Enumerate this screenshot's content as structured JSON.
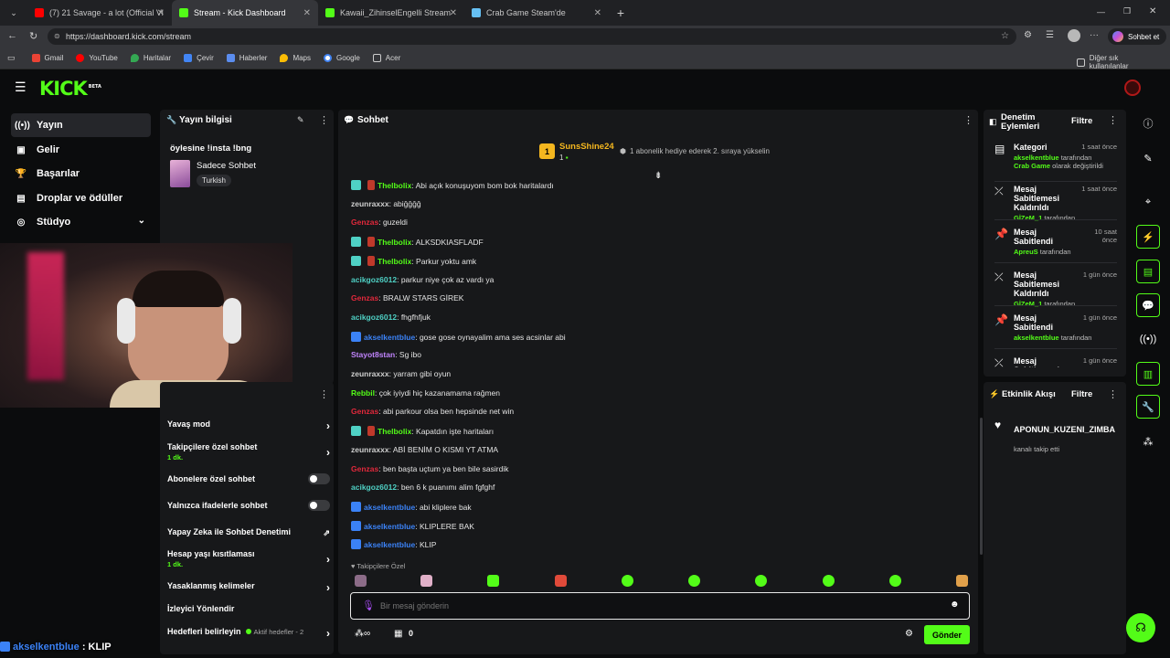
{
  "browser": {
    "tabs": [
      {
        "title": "(7) 21 Savage - a lot (Official Vide",
        "color": "#ff0000"
      },
      {
        "title": "Stream - Kick Dashboard",
        "color": "#53fc18"
      },
      {
        "title": "Kawaii_ZihinselEngelli Stream - W",
        "color": "#53fc18"
      },
      {
        "title": "Crab Game Steam'de",
        "color": "#66c0f4"
      }
    ],
    "url": "https://dashboard.kick.com/stream",
    "profile_button": "Sohbet et",
    "bookmarks": [
      "Gmail",
      "YouTube",
      "Haritalar",
      "Çevir",
      "Haberler",
      "Maps",
      "Google",
      "Acer"
    ],
    "other_bookmarks": "Diğer sık kullanılanlar"
  },
  "app": {
    "logo": "KICK",
    "logo_badge": "BETA",
    "nav": [
      {
        "label": "Yayın",
        "icon": "broadcast-icon"
      },
      {
        "label": "Gelir",
        "icon": "revenue-icon"
      },
      {
        "label": "Başarılar",
        "icon": "trophy-icon"
      },
      {
        "label": "Droplar ve ödüller",
        "icon": "gift-icon"
      },
      {
        "label": "Stüdyo",
        "icon": "studio-icon"
      }
    ],
    "stream_info": {
      "header": "Yayın bilgisi",
      "title": "öylesine !insta !bng",
      "category": "Sadece Sohbet",
      "tag": "Turkish"
    },
    "chat_settings": [
      {
        "label": "Yavaş mod",
        "sub": "",
        "control": "chevron"
      },
      {
        "label": "Takipçilere özel sohbet",
        "sub": "1 dk.",
        "control": "chevron"
      },
      {
        "label": "Abonelere özel sohbet",
        "sub": "",
        "control": "toggle"
      },
      {
        "label": "Yalnızca ifadelerle sohbet",
        "sub": "",
        "control": "toggle"
      },
      {
        "label": "Yapay Zeka ile Sohbet Denetimi",
        "sub": "",
        "control": "chart"
      },
      {
        "label": "Hesap yaşı kısıtlaması",
        "sub": "1 dk.",
        "control": "chevron"
      },
      {
        "label": "Yasaklanmış kelimeler",
        "sub": "",
        "control": "chevron"
      },
      {
        "label": "İzleyici Yönlendir",
        "sub": "",
        "control": "none"
      },
      {
        "label": "Hedefleri belirleyin",
        "sub": "",
        "control": "chevron",
        "extra": "Aktif hedefler - 2"
      }
    ],
    "overlay_caption": {
      "user": "akselkentblue",
      "text": " : KLIP"
    },
    "chat": {
      "header": "Sohbet",
      "gifter": {
        "name": "SunsShine24",
        "count": "1",
        "rank": "1",
        "message": "1 abonelik hediye ederek 2. sıraya yükselin"
      },
      "messages": [
        {
          "user": "Thelbolix",
          "color": "#53fc18",
          "badges": true,
          "text": ": Abi açık konuşuyom bom bok haritalardı"
        },
        {
          "user": "zeunraxxx",
          "color": "#cfcfcf",
          "badges": false,
          "text": ": abiğğğğ"
        },
        {
          "user": "Genzas",
          "color": "#e0283b",
          "badges": false,
          "text": ": guzeldi"
        },
        {
          "user": "Thelbolix",
          "color": "#53fc18",
          "badges": true,
          "text": ": ALKSDKIASFLADF"
        },
        {
          "user": "Thelbolix",
          "color": "#53fc18",
          "badges": true,
          "text": ": Parkur yoktu amk"
        },
        {
          "user": "acikgoz6012",
          "color": "#4fd1c5",
          "badges": false,
          "text": ": parkur niye çok az vardı ya"
        },
        {
          "user": "Genzas",
          "color": "#e0283b",
          "badges": false,
          "text": ": BRALW STARS GİREK"
        },
        {
          "user": "acikgoz6012",
          "color": "#4fd1c5",
          "badges": false,
          "text": ": fhgfhfjuk"
        },
        {
          "user": "akselkentblue",
          "color": "#3b82f6",
          "badges": "mod",
          "text": ": gose gose oynayalim ama ses acsinlar abi"
        },
        {
          "user": "Stayot8stan",
          "color": "#c084fc",
          "badges": false,
          "text": ": Sg ibo"
        },
        {
          "user": "zeunraxxx",
          "color": "#cfcfcf",
          "badges": false,
          "text": ": yarram gibi oyun"
        },
        {
          "user": "Rebbil",
          "color": "#53fc18",
          "badges": false,
          "text": ": çok iyiydi hiç kazanamama rağmen"
        },
        {
          "user": "Genzas",
          "color": "#e0283b",
          "badges": false,
          "text": ": abi parkour olsa ben hepsinde net win"
        },
        {
          "user": "Thelbolix",
          "color": "#53fc18",
          "badges": true,
          "text": ": Kapatdın işte haritaları"
        },
        {
          "user": "zeunraxxx",
          "color": "#cfcfcf",
          "badges": false,
          "text": ": ABİ BENİM O KISMI YT ATMA"
        },
        {
          "user": "Genzas",
          "color": "#e0283b",
          "badges": false,
          "text": ": ben başta uçtum ya ben bile sasirdik"
        },
        {
          "user": "acikgoz6012",
          "color": "#4fd1c5",
          "badges": false,
          "text": ": ben 6 k puanımı alim fgfghf"
        },
        {
          "user": "akselkentblue",
          "color": "#3b82f6",
          "badges": "mod",
          "text": ": abi kliplere bak"
        },
        {
          "user": "akselkentblue",
          "color": "#3b82f6",
          "badges": "mod",
          "text": ": KLIPLERE BAK"
        },
        {
          "user": "akselkentblue",
          "color": "#3b82f6",
          "badges": "mod",
          "text": ": KLIP"
        }
      ],
      "followers_only_label": "Takipçilere Özel",
      "input_placeholder": "Bir mesaj gönderin",
      "points": "0",
      "send": "Gönder"
    },
    "moderation": {
      "header": "Denetim Eylemleri",
      "filter": "Filtre",
      "items": [
        {
          "title": "Kategori",
          "time": "1 saat önce",
          "line1_user": "akselkentblue",
          "line1_rest": " tarafından",
          "line2_user": "Crab Game",
          "line2_rest": " olarak değiştirildi",
          "icon": "category-icon"
        },
        {
          "title": "Mesaj Sabitlemesi Kaldırıldı",
          "time": "1 saat önce",
          "line1_user": "GİZeM_1",
          "line1_rest": " tarafından",
          "icon": "unpin-icon"
        },
        {
          "title": "Mesaj Sabitlendi",
          "time": "10 saat önce",
          "line1_user": "ApreuS",
          "line1_rest": " tarafından",
          "icon": "pin-icon"
        },
        {
          "title": "Mesaj Sabitlemesi Kaldırıldı",
          "time": "1 gün önce",
          "line1_user": "GİZeM_1",
          "line1_rest": " tarafından",
          "icon": "unpin-icon"
        },
        {
          "title": "Mesaj Sabitlendi",
          "time": "1 gün önce",
          "line1_user": "akselkentblue",
          "line1_rest": " tarafından",
          "icon": "pin-icon"
        },
        {
          "title": "Mesaj Sabitlemesi Kaldırıldı",
          "time": "1 gün önce",
          "line1_user": "",
          "line1_rest": "",
          "icon": "unpin-icon"
        }
      ]
    },
    "activity": {
      "header": "Etkinlik Akışı",
      "filter": "Filtre",
      "item_user": "APONUN_KUZENI_ZIMBA",
      "item_text": "kanalı takip etti"
    }
  }
}
